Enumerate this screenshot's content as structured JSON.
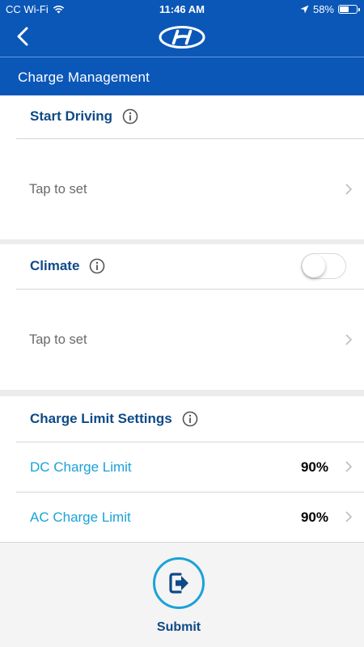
{
  "status_bar": {
    "carrier": "CC Wi-Fi",
    "time": "11:46 AM",
    "battery_percent": "58%",
    "battery_level": 0.58,
    "icons": [
      "wifi-icon",
      "location-arrow-icon",
      "battery-icon"
    ]
  },
  "nav": {
    "back_icon": "chevron-left-icon",
    "logo": "hyundai-logo"
  },
  "page_title": "Charge Management",
  "start_driving": {
    "label": "Start Driving",
    "info_icon": "info-icon",
    "tap_text": "Tap to set"
  },
  "climate": {
    "label": "Climate",
    "info_icon": "info-icon",
    "toggle_on": false,
    "tap_text": "Tap to set"
  },
  "charge_limit": {
    "label": "Charge Limit Settings",
    "info_icon": "info-icon",
    "items": [
      {
        "label": "DC Charge Limit",
        "value": "90%"
      },
      {
        "label": "AC Charge Limit",
        "value": "90%"
      }
    ]
  },
  "submit": {
    "label": "Submit",
    "icon": "exit-arrow-icon"
  },
  "colors": {
    "header_blue": "#0b57b8",
    "heading_text": "#0e4a86",
    "accent_cyan": "#1aa2d8",
    "page_background": "#ececec"
  }
}
